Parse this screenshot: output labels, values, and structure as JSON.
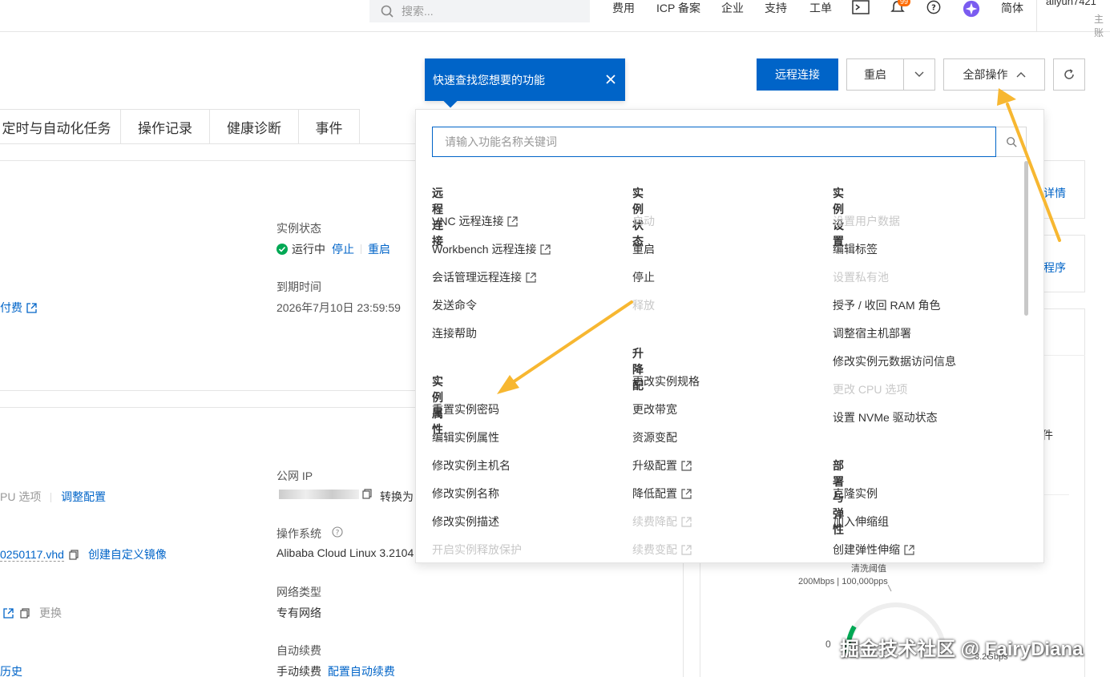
{
  "topbar": {
    "search_placeholder": "搜索...",
    "nav": [
      "费用",
      "ICP 备案",
      "企业",
      "支持",
      "工单"
    ],
    "locale": "简体",
    "user": "aliyun7421",
    "user_sub": "主账",
    "bell_badge": "99"
  },
  "toolbar": {
    "remote_connect": "远程连接",
    "restart": "重启",
    "all_actions": "全部操作"
  },
  "tooltip": {
    "text": "快速查找您想要的功能"
  },
  "tabs": [
    "定时与自动化任务",
    "操作记录",
    "健康诊断",
    "事件"
  ],
  "dropdown": {
    "search_placeholder": "请输入功能名称关键词",
    "col1": {
      "sections": [
        {
          "title": "远程连接",
          "items": [
            {
              "label": "VNC 远程连接",
              "ext": true,
              "enabled": true
            },
            {
              "label": "Workbench 远程连接",
              "ext": true,
              "enabled": true
            },
            {
              "label": "会话管理远程连接",
              "ext": true,
              "enabled": true
            },
            {
              "label": "发送命令",
              "ext": false,
              "enabled": true
            },
            {
              "label": "连接帮助",
              "ext": false,
              "enabled": true
            }
          ]
        },
        {
          "title": "实例属性",
          "items": [
            {
              "label": "重置实例密码",
              "ext": false,
              "enabled": true
            },
            {
              "label": "编辑实例属性",
              "ext": false,
              "enabled": true
            },
            {
              "label": "修改实例主机名",
              "ext": false,
              "enabled": true
            },
            {
              "label": "修改实例名称",
              "ext": false,
              "enabled": true
            },
            {
              "label": "修改实例描述",
              "ext": false,
              "enabled": true
            },
            {
              "label": "开启实例释放保护",
              "ext": false,
              "enabled": false
            }
          ]
        }
      ]
    },
    "col2": {
      "sections": [
        {
          "title": "实例状态",
          "items": [
            {
              "label": "启动",
              "ext": false,
              "enabled": false
            },
            {
              "label": "重启",
              "ext": false,
              "enabled": true
            },
            {
              "label": "停止",
              "ext": false,
              "enabled": true
            },
            {
              "label": "释放",
              "ext": false,
              "enabled": false
            }
          ]
        },
        {
          "title": "升降配",
          "items": [
            {
              "label": "更改实例规格",
              "ext": false,
              "enabled": true
            },
            {
              "label": "更改带宽",
              "ext": false,
              "enabled": true
            },
            {
              "label": "资源变配",
              "ext": false,
              "enabled": true
            },
            {
              "label": "升级配置",
              "ext": true,
              "enabled": true
            },
            {
              "label": "降低配置",
              "ext": true,
              "enabled": true
            },
            {
              "label": "续费降配",
              "ext": true,
              "enabled": false
            },
            {
              "label": "续费变配",
              "ext": true,
              "enabled": false
            }
          ]
        }
      ]
    },
    "col3": {
      "sections": [
        {
          "title": "实例设置",
          "items": [
            {
              "label": "设置用户数据",
              "ext": false,
              "enabled": false
            },
            {
              "label": "编辑标签",
              "ext": false,
              "enabled": true
            },
            {
              "label": "设置私有池",
              "ext": false,
              "enabled": false
            },
            {
              "label": "授予 / 收回 RAM 角色",
              "ext": false,
              "enabled": true
            },
            {
              "label": "调整宿主机部署",
              "ext": false,
              "enabled": true
            },
            {
              "label": "修改实例元数据访问信息",
              "ext": false,
              "enabled": true
            },
            {
              "label": "更改 CPU 选项",
              "ext": false,
              "enabled": false
            },
            {
              "label": "设置 NVMe 驱动状态",
              "ext": false,
              "enabled": true
            }
          ]
        },
        {
          "title": "部署与弹性",
          "items": [
            {
              "label": "克隆实例",
              "ext": false,
              "enabled": true
            },
            {
              "label": "加入伸缩组",
              "ext": false,
              "enabled": true
            },
            {
              "label": "创建弹性伸缩",
              "ext": true,
              "enabled": true
            }
          ]
        }
      ]
    }
  },
  "background": {
    "instance_status_label": "实例状态",
    "status_running": "运行中",
    "stop": "停止",
    "restart": "重启",
    "expire_label": "到期时间",
    "expire_value": "2026年7月10日 23:59:59",
    "billing_fragment": "付费",
    "cpu_fragment": "PU 选项",
    "adjust_config": "调整配置",
    "public_ip_label": "公网 IP",
    "convert_fragment": "转换为",
    "vhd_fragment": "0250117.vhd",
    "create_image": "创建自定义镜像",
    "os_label": "操作系统",
    "os_value": "Alibaba Cloud Linux 3.2104",
    "replace": "更换",
    "network_type_label": "网络类型",
    "network_type_value": "专有网络",
    "auto_renew_label": "自动续费",
    "manual_renew": "手动续费",
    "config_auto_renew": "配置自动续费",
    "history_fragment": "历史",
    "details_fragment": "详情",
    "program_fragment": "程序",
    "item_fragment": "件",
    "throttle_label": "清洗阈值",
    "throttle_value": "200Mbps | 100,000pps",
    "gauge_zero": "0",
    "gauge_max": "3.2Gbps"
  },
  "watermark": "掘金技术社区 @ FairyDiana",
  "colors": {
    "primary": "#0064c8",
    "arrow": "#f7b731",
    "success": "#00a854"
  }
}
